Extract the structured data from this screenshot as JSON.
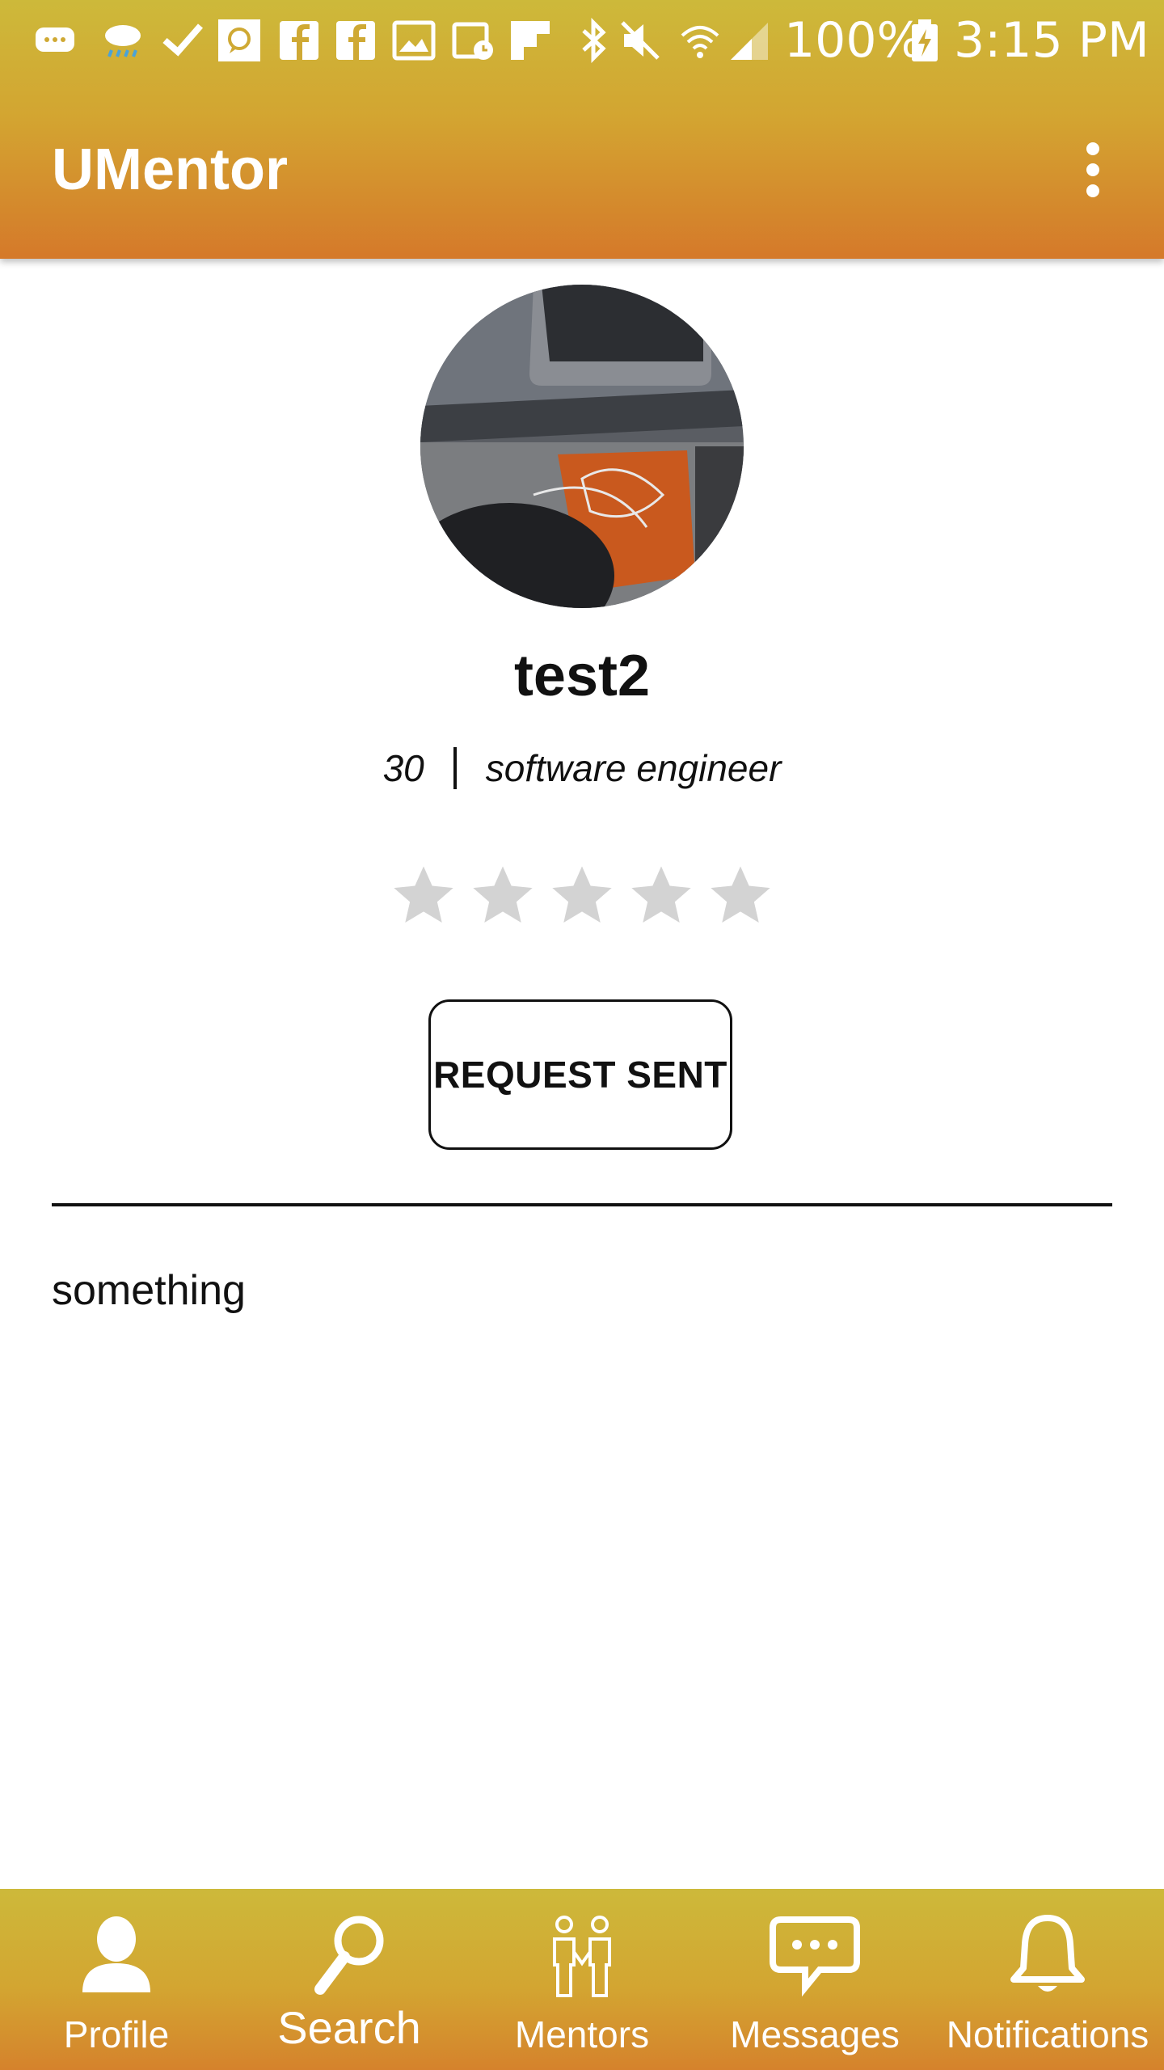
{
  "status_bar": {
    "battery": "100%",
    "time": "3:15 PM",
    "icons": [
      "message-icon",
      "weather-rain-icon",
      "check-icon",
      "chat-bubble-icon",
      "facebook-icon",
      "facebook-icon",
      "image-icon",
      "calendar-icon",
      "flipboard-icon",
      "bluetooth-icon",
      "mute-icon",
      "wifi-icon",
      "signal-icon",
      "battery-charging-icon"
    ]
  },
  "app_bar": {
    "title": "UMentor",
    "menu_icon": "more-vert-icon"
  },
  "profile": {
    "name": "test2",
    "age": "30",
    "occupation": "software engineer",
    "rating": 0,
    "rating_max": 5,
    "request_button": "REQUEST SENT",
    "bio": "something"
  },
  "bottom_nav": {
    "items": [
      {
        "label": "Profile",
        "icon": "person-icon"
      },
      {
        "label": "Search",
        "icon": "search-icon",
        "active": true
      },
      {
        "label": "Mentors",
        "icon": "mentors-icon"
      },
      {
        "label": "Messages",
        "icon": "message-bubble-icon"
      },
      {
        "label": "Notifications",
        "icon": "bell-icon"
      }
    ]
  },
  "colors": {
    "bar_top": "#cdb93a",
    "bar_bottom": "#d5792a",
    "star_empty": "#d3d3d3"
  }
}
